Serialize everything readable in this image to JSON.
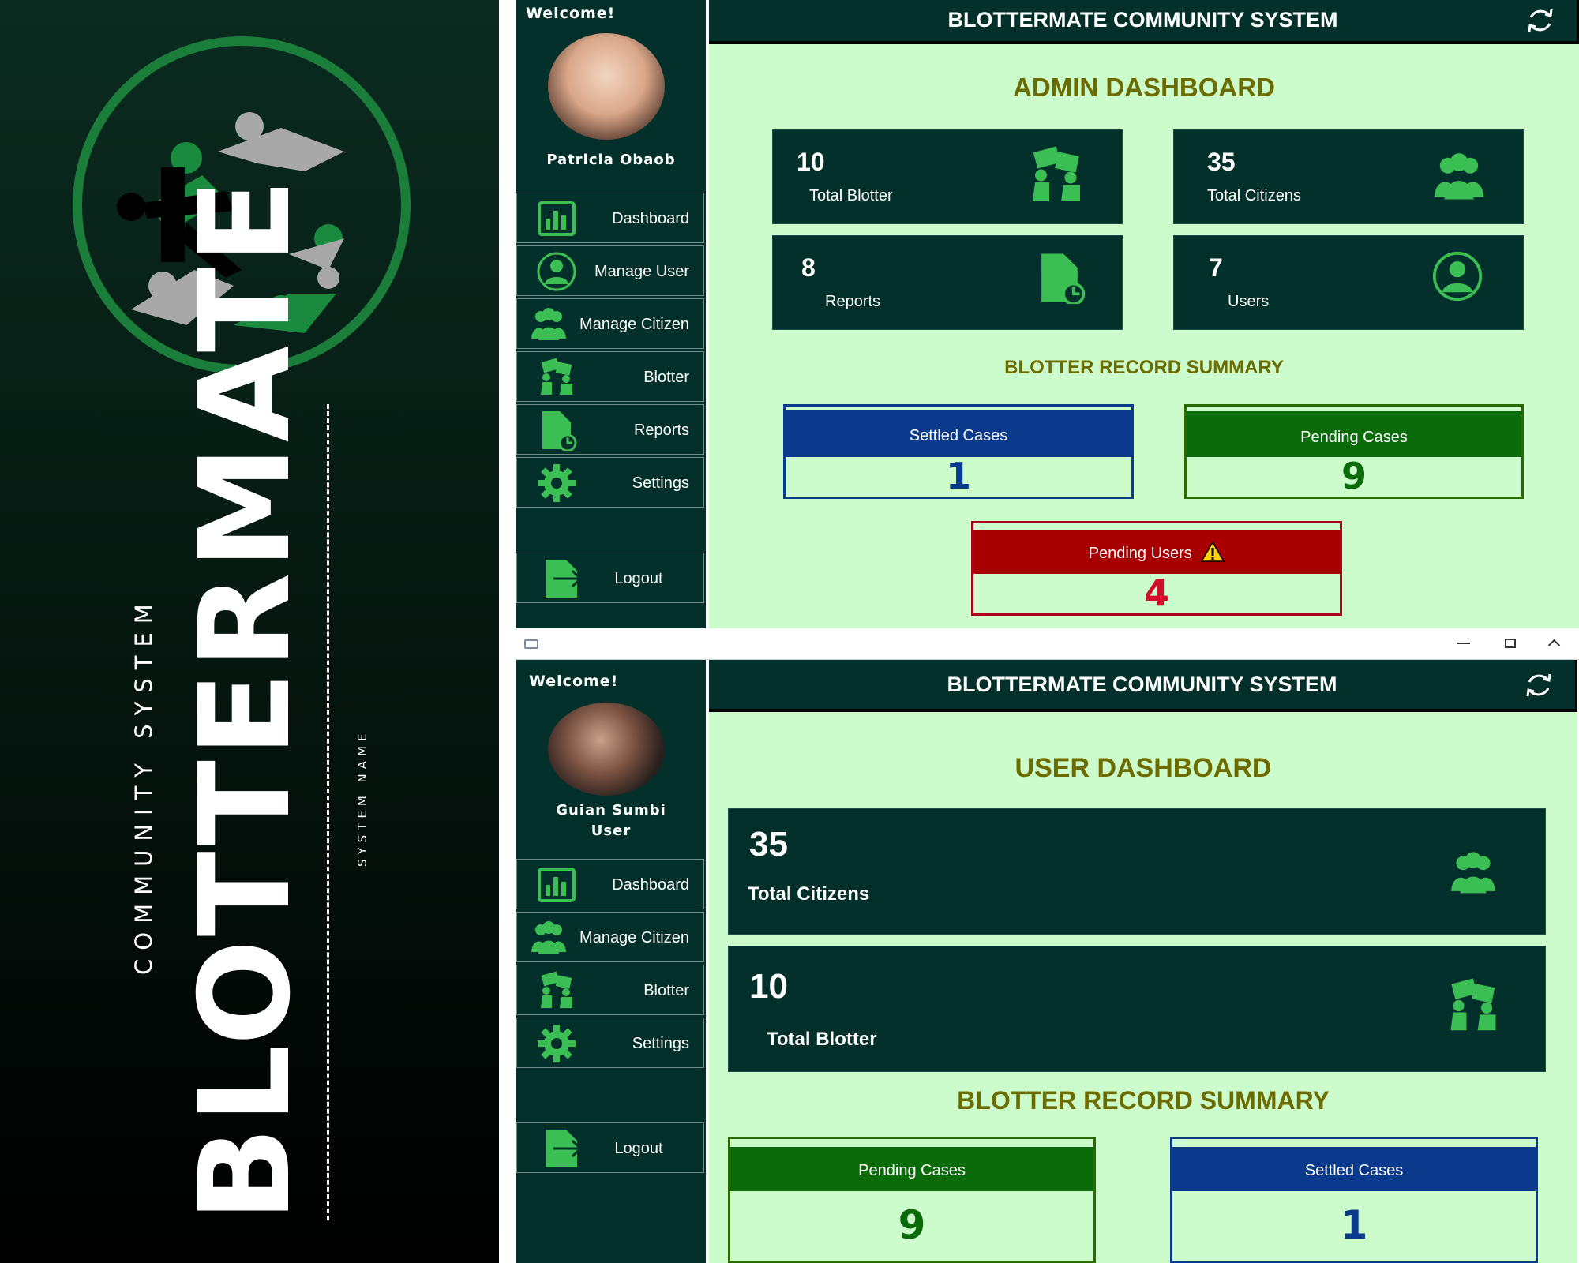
{
  "branding": {
    "title": "BLOTTERMATE",
    "subtitle": "COMMUNITY SYSTEM",
    "system_name": "SYSTEM NAME",
    "logo_icon": "community-people-logo"
  },
  "colors": {
    "sidebar": "#04302b",
    "content_bg": "#ccfccc",
    "accent_green": "#3bbf55",
    "settled_blue": "#0b3a8c",
    "pending_green": "#0b6b0b",
    "pending_users_red": "#a80000",
    "title_olive": "#6b6b00"
  },
  "admin": {
    "welcome": "Welcome!",
    "user_name": "Patricia Obaob",
    "app_title": "BLOTTERMATE COMMUNITY SYSTEM",
    "refresh_icon": "refresh-icon",
    "dashboard_title": "ADMIN DASHBOARD",
    "nav": [
      {
        "label": "Dashboard",
        "icon": "bar-chart-icon"
      },
      {
        "label": "Manage User",
        "icon": "user-circle-icon"
      },
      {
        "label": "Manage Citizen",
        "icon": "people-icon"
      },
      {
        "label": "Blotter",
        "icon": "blotter-icon"
      },
      {
        "label": "Reports",
        "icon": "report-icon"
      },
      {
        "label": "Settings",
        "icon": "gear-icon"
      },
      {
        "label": "Logout",
        "icon": "logout-icon"
      }
    ],
    "cards": [
      {
        "value": "10",
        "label": "Total Blotter",
        "icon": "blotter-icon"
      },
      {
        "value": "35",
        "label": "Total Citizens",
        "icon": "people-icon"
      },
      {
        "value": "8",
        "label": "Reports",
        "icon": "report-icon"
      },
      {
        "value": "7",
        "label": "Users",
        "icon": "user-circle-icon"
      }
    ],
    "summary_title": "BLOTTER RECORD SUMMARY",
    "summary": [
      {
        "label": "Settled Cases",
        "value": "1"
      },
      {
        "label": "Pending Cases",
        "value": "9"
      },
      {
        "label": "Pending Users",
        "value": "4",
        "icon": "warning-icon"
      }
    ]
  },
  "user": {
    "window_controls": [
      "minimize-icon",
      "maximize-icon",
      "collapse-icon"
    ],
    "welcome": "Welcome!",
    "user_name": "Guian Sumbi",
    "user_role": "User",
    "app_title": "BLOTTERMATE COMMUNITY SYSTEM",
    "refresh_icon": "refresh-icon",
    "dashboard_title": "USER DASHBOARD",
    "nav": [
      {
        "label": "Dashboard",
        "icon": "bar-chart-icon"
      },
      {
        "label": "Manage Citizen",
        "icon": "people-icon"
      },
      {
        "label": "Blotter",
        "icon": "blotter-icon"
      },
      {
        "label": "Settings",
        "icon": "gear-icon"
      },
      {
        "label": "Logout",
        "icon": "logout-icon"
      }
    ],
    "cards": [
      {
        "value": "35",
        "label": "Total Citizens",
        "icon": "people-icon"
      },
      {
        "value": "10",
        "label": "Total Blotter",
        "icon": "blotter-icon"
      }
    ],
    "summary_title": "BLOTTER RECORD SUMMARY",
    "summary": [
      {
        "label": "Pending Cases",
        "value": "9"
      },
      {
        "label": "Settled Cases",
        "value": "1"
      }
    ]
  }
}
